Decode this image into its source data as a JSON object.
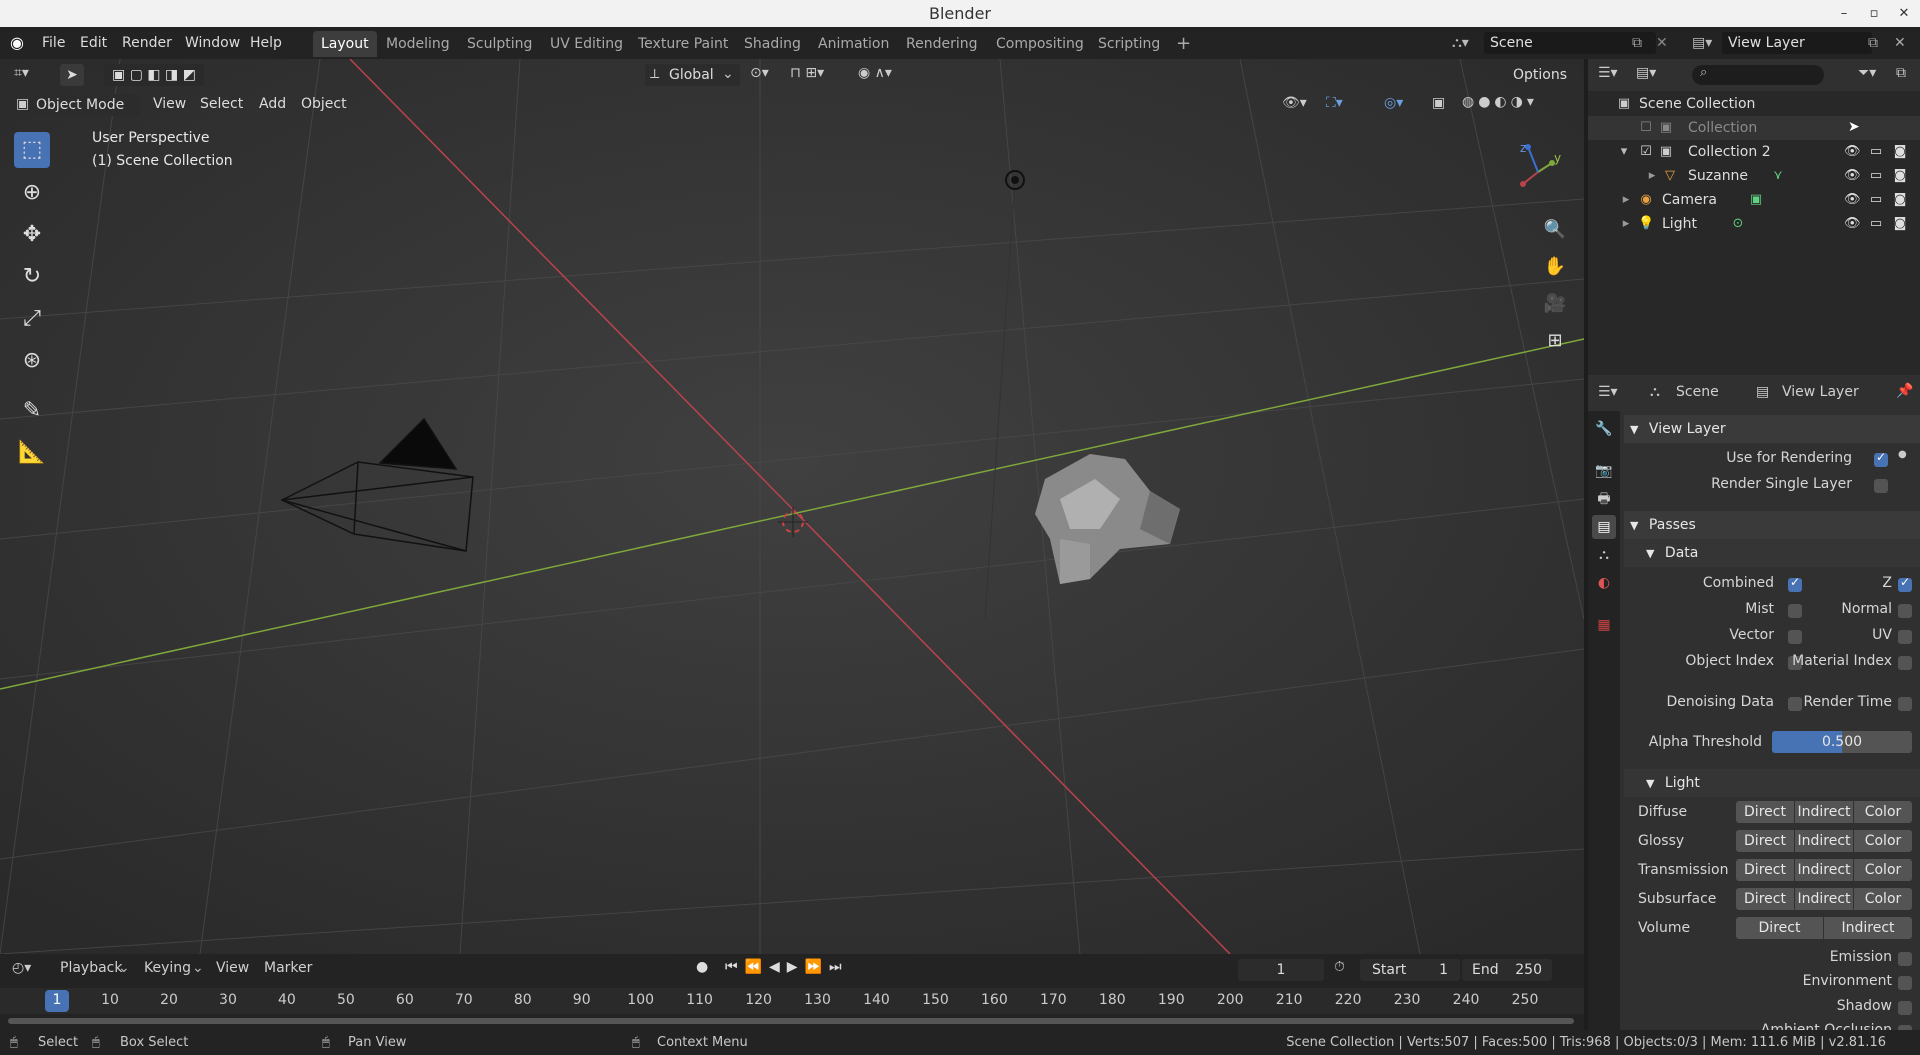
{
  "window": {
    "title": "Blender",
    "controls": [
      "–",
      "▫",
      "✕"
    ]
  },
  "menu": [
    "File",
    "Edit",
    "Render",
    "Window",
    "Help"
  ],
  "workspaces": [
    "Layout",
    "Modeling",
    "Sculpting",
    "UV Editing",
    "Texture Paint",
    "Shading",
    "Animation",
    "Rendering",
    "Compositing",
    "Scripting",
    "+"
  ],
  "scene": {
    "name": "Scene",
    "view_layer": "View Layer"
  },
  "viewport": {
    "mode": "Object Mode",
    "header_menus": [
      "View",
      "Select",
      "Add",
      "Object"
    ],
    "orientation": "Global",
    "options_label": "Options",
    "overlay_title": "User Perspective",
    "overlay_subtitle": "(1) Scene Collection",
    "gizmo_z": "z",
    "gizmo_y": "y"
  },
  "outliner": {
    "root": "Scene Collection",
    "rows": [
      {
        "label": "Collection"
      },
      {
        "label": "Collection 2"
      },
      {
        "label": "Suzanne"
      },
      {
        "label": "Camera"
      },
      {
        "label": "Light"
      }
    ]
  },
  "properties": {
    "header_scene": "Scene",
    "header_view_layer": "View Layer",
    "view_layer_section": "View Layer",
    "use_for_rendering": {
      "label": "Use for Rendering",
      "checked": true
    },
    "render_single_layer": {
      "label": "Render Single Layer",
      "checked": false
    },
    "passes_section": "Passes",
    "data_section": "Data",
    "data_left": [
      {
        "label": "Combined",
        "checked": true
      },
      {
        "label": "Mist",
        "checked": false
      },
      {
        "label": "Vector",
        "checked": false
      },
      {
        "label": "Object Index",
        "checked": false
      }
    ],
    "data_right": [
      {
        "label": "Z",
        "checked": true
      },
      {
        "label": "Normal",
        "checked": false
      },
      {
        "label": "UV",
        "checked": false
      },
      {
        "label": "Material Index",
        "checked": false
      }
    ],
    "denoising": {
      "label": "Denoising Data",
      "checked": false
    },
    "render_time": {
      "label": "Render Time",
      "checked": false
    },
    "alpha_threshold": {
      "label": "Alpha Threshold",
      "value": "0.500"
    },
    "light_section": "Light",
    "light_rows": [
      {
        "label": "Diffuse",
        "buttons": [
          "Direct",
          "Indirect",
          "Color"
        ]
      },
      {
        "label": "Glossy",
        "buttons": [
          "Direct",
          "Indirect",
          "Color"
        ]
      },
      {
        "label": "Transmission",
        "buttons": [
          "Direct",
          "Indirect",
          "Color"
        ]
      },
      {
        "label": "Subsurface",
        "buttons": [
          "Direct",
          "Indirect",
          "Color"
        ]
      },
      {
        "label": "Volume",
        "buttons": [
          "Direct",
          "Indirect"
        ]
      }
    ],
    "extra_checks": [
      {
        "label": "Emission",
        "checked": false
      },
      {
        "label": "Environment",
        "checked": false
      },
      {
        "label": "Shadow",
        "checked": false
      },
      {
        "label": "Ambient Occlusion",
        "checked": false
      }
    ]
  },
  "timeline": {
    "menus": [
      "Playback",
      "Keying",
      "View",
      "Marker"
    ],
    "current_frame": "1",
    "start_label": "Start",
    "start": "1",
    "end_label": "End",
    "end": "250",
    "ticks": [
      "1",
      "10",
      "20",
      "30",
      "40",
      "50",
      "60",
      "70",
      "80",
      "90",
      "100",
      "110",
      "120",
      "130",
      "140",
      "150",
      "160",
      "170",
      "180",
      "190",
      "200",
      "210",
      "220",
      "230",
      "240",
      "250"
    ]
  },
  "status": {
    "select": "Select",
    "box_select": "Box Select",
    "pan_view": "Pan View",
    "context_menu": "Context Menu",
    "info": "Scene Collection | Verts:507 | Faces:500 | Tris:968 | Objects:0/3 | Mem: 111.6 MiB | v2.81.16"
  }
}
